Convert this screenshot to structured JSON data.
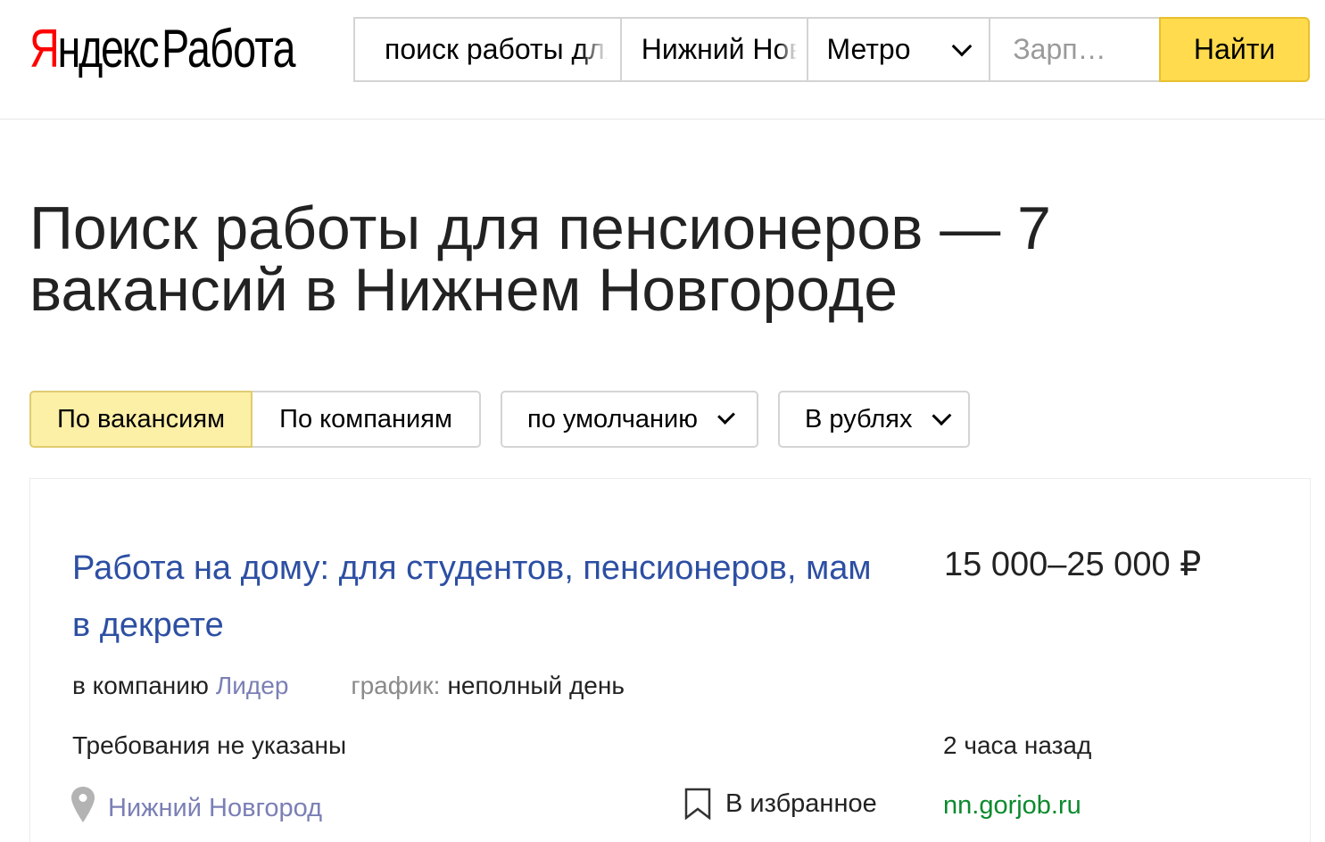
{
  "header": {
    "logo_brand_first": "Я",
    "logo_brand_rest": "ндекс",
    "logo_service": "Работа",
    "search": {
      "query_value": "поиск работы для пенсионеров",
      "city_value": "Нижний Новгород",
      "metro_label": "Метро",
      "salary_placeholder": "Зарп…",
      "find_label": "Найти"
    }
  },
  "page": {
    "title": "Поиск работы для пенсионеров — 7 вакансий в Нижнем Новгороде"
  },
  "filters": {
    "by_vacancies": "По вакансиям",
    "by_companies": "По компаниям",
    "sort": "по умолчанию",
    "currency": "В рублях"
  },
  "vacancy": {
    "title": "Работа на дому: для студентов, пенсионеров, мам в декрете",
    "salary": "15 000–25 000 ₽",
    "company_prefix": "в компанию",
    "company": "Лидер",
    "schedule_label": "график:",
    "schedule": "неполный день",
    "requirements": "Требования не указаны",
    "posted": "2 часа назад",
    "location": "Нижний Новгород",
    "favorite": "В избранное",
    "source": "nn.gorjob.ru"
  },
  "colors": {
    "accent_yellow": "#ffdb4d",
    "link_blue": "#2d4fa3",
    "source_green": "#0b8a2d",
    "logo_red": "#ff0000"
  }
}
